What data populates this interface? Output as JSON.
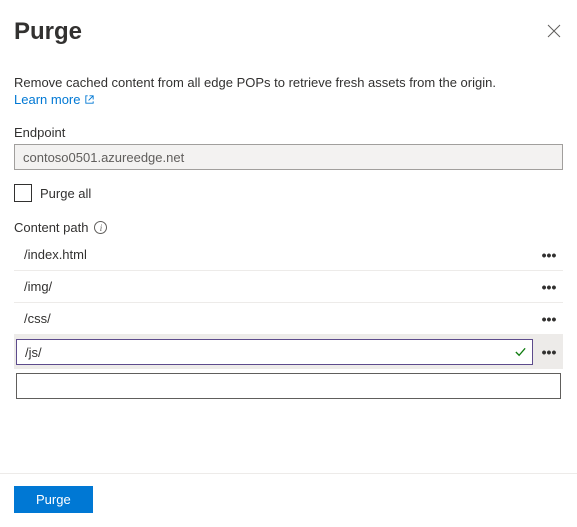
{
  "header": {
    "title": "Purge"
  },
  "description": "Remove cached content from all edge POPs to retrieve fresh assets from the origin.",
  "learn_more_label": "Learn more",
  "endpoint": {
    "label": "Endpoint",
    "value": "contoso0501.azureedge.net"
  },
  "purge_all": {
    "label": "Purge all",
    "checked": false
  },
  "content_path": {
    "label": "Content path",
    "rows": [
      {
        "value": "/index.html",
        "editing": false
      },
      {
        "value": "/img/",
        "editing": false
      },
      {
        "value": "/css/",
        "editing": false
      },
      {
        "value": "/js/",
        "editing": true,
        "valid": true
      }
    ],
    "blank_value": ""
  },
  "footer": {
    "purge_button": "Purge"
  }
}
